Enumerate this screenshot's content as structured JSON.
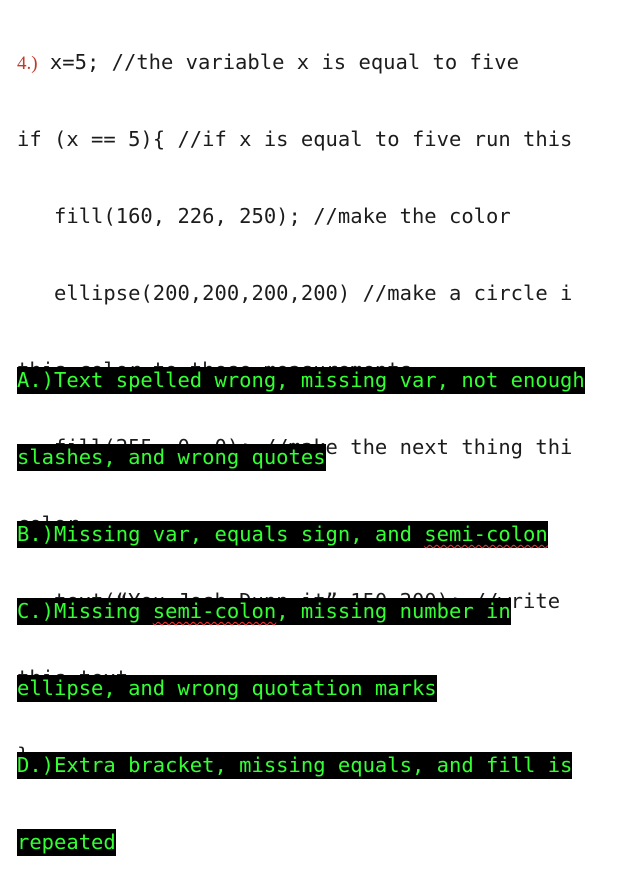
{
  "question": {
    "number": "4.)",
    "code_lines": [
      " x=5; //the variable x is equal to five",
      "if (x == 5){ //if x is equal to five run this",
      "   fill(160, 226, 250); //make the color",
      "   ellipse(200,200,200,200) //make a circle i",
      "this color to these measurements",
      "   fill(255, 0, 0); //make the next thing thi",
      "color",
      "   text(“You Josh Dunn it”,150,200); //write",
      "this text",
      "}"
    ]
  },
  "answers": {
    "a_line1": "A.)Text spelled wrong, missing var, not enough",
    "a_line2": "slashes, and wrong quotes",
    "b_prefix": "B.)Missing var, equals sign, and ",
    "b_squiggle": "semi-colon",
    "c_prefix": "C.)Missing ",
    "c_squiggle": "semi-colon",
    "c_suffix": ", missing number in",
    "c_line2": "ellipse, and wrong quotation marks",
    "d_line1": "D.)Extra bracket, missing equals, and fill is",
    "d_line2": "repeated"
  },
  "colors": {
    "highlight_background": "#000000",
    "highlight_text": "#33ff33",
    "question_number": "#c0392b",
    "spellcheck_underline": "#ff3333"
  }
}
